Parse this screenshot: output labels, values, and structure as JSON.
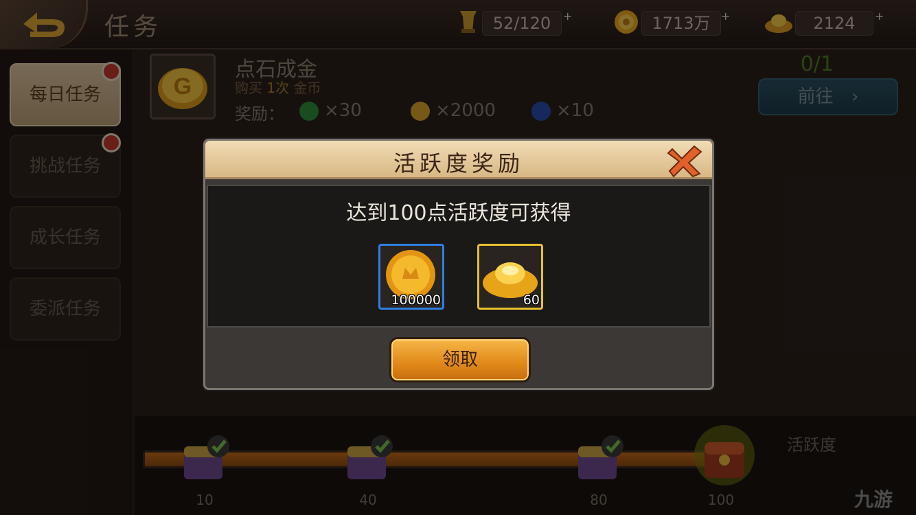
{
  "header": {
    "title": "任务",
    "resources": [
      {
        "icon": "stamina-icon",
        "value": "52/120"
      },
      {
        "icon": "coin-icon",
        "value": "1713万"
      },
      {
        "icon": "ingot-icon",
        "value": "2124"
      }
    ]
  },
  "sidebar": {
    "tabs": [
      {
        "label": "每日任务",
        "active": true,
        "badge": true
      },
      {
        "label": "挑战任务",
        "active": false,
        "badge": true
      },
      {
        "label": "成长任务",
        "active": false,
        "badge": false
      },
      {
        "label": "委派任务",
        "active": false,
        "badge": false
      }
    ]
  },
  "task": {
    "name": "点石成金",
    "desc_prefix": "购买",
    "desc_count": "1次",
    "desc_suffix": "金币",
    "reward_label": "奖励：",
    "rewards": [
      {
        "icon": "green-gem-icon",
        "text": "×30"
      },
      {
        "icon": "coin-icon",
        "text": "×2000"
      },
      {
        "icon": "blue-swirl-icon",
        "text": "×10"
      }
    ],
    "progress": "0/1",
    "goto_label": "前往"
  },
  "activity": {
    "label": "活跃度",
    "milestones": [
      "10",
      "40",
      "80",
      "100"
    ],
    "completed": [
      true,
      true,
      true,
      false
    ]
  },
  "modal": {
    "title": "活跃度奖励",
    "description": "达到100点活跃度可获得",
    "items": [
      {
        "name": "coin",
        "quantity": "100000",
        "border": "#2f7fe0"
      },
      {
        "name": "ingot",
        "quantity": "60",
        "border": "#e8c12e"
      }
    ],
    "claim_label": "领取"
  },
  "watermark": "九游"
}
